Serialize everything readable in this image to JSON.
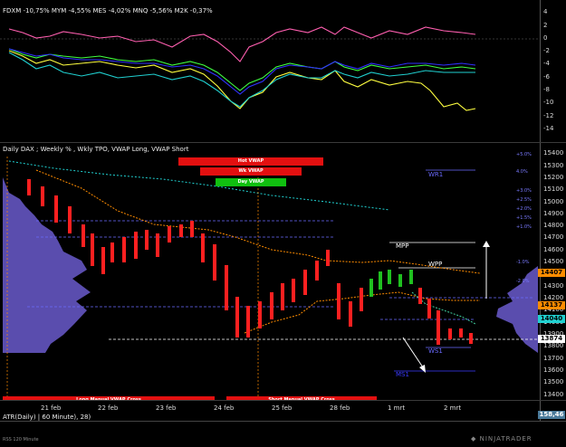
{
  "top_panel": {
    "header": "FDXM -10,75%  MYM -4,55%  MES -4,02%  MNQ -5,56%  M2K -0,37%",
    "y_ticks": [
      "4",
      "2",
      "0",
      "-2",
      "-4",
      "-6",
      "-8",
      "-10",
      "-12",
      "-14"
    ],
    "colors": {
      "fdxm": "#ff5fb0",
      "mym": "#ffff40",
      "mes": "#40ff40",
      "mnq": "#3030ff",
      "m2k": "#20d0d0"
    }
  },
  "main_panel": {
    "header": "Daily DAX ; Weekly % , Wkly TPO, VWAP Long, VWAP Short",
    "y_ticks": [
      "15400",
      "15300",
      "15200",
      "15100",
      "15000",
      "14900",
      "14800",
      "14700",
      "14600",
      "14500",
      "14400",
      "14300",
      "14200",
      "14100",
      "14000",
      "13900",
      "13800",
      "13700",
      "13600",
      "13500",
      "13400"
    ],
    "bars": {
      "hot": "Hot VWAP",
      "wk": "Wk VWAP",
      "day": "Day VWAP"
    },
    "bottom_bars": {
      "long": "Long Manual VWAP Cross",
      "short": "Short Manual VWAP Cross"
    },
    "levels": {
      "wr1": "WR1",
      "mpp": "MPP",
      "wpp": "WPP",
      "ws1": "WS1",
      "ms1": "MS1"
    },
    "pct_labels": [
      "+5.0%",
      "4.0%",
      "+3.0%",
      "+2.5%",
      "+2.0%",
      "+1.5%",
      "+1.0%",
      "-1.0%",
      "-2.0%"
    ],
    "price_tags": [
      {
        "value": "14407",
        "color": "#ff8c00"
      },
      {
        "value": "14137",
        "color": "#ff8c00"
      },
      {
        "value": "14040",
        "color": "#20d0d0"
      },
      {
        "value": "13874",
        "color": "#ffffff"
      }
    ]
  },
  "indicator_panel": {
    "header": "ATR(Daily) | 60 Minute), 28)",
    "value_tag": "158,46"
  },
  "x_axis": {
    "labels": [
      "21 feb",
      "22 feb",
      "23 feb",
      "24 feb",
      "25 feb",
      "28 feb",
      "1 mrt",
      "2 mrt"
    ]
  },
  "footer": {
    "left": "RSS 120 Minute",
    "brand": "NINJATRADER"
  }
}
